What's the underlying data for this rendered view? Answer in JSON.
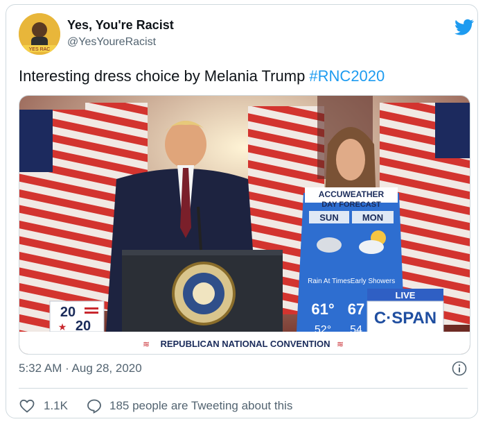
{
  "account": {
    "display_name": "Yes, You're Racist",
    "handle": "@YesYoureRacist",
    "avatar_badge_text": "YES RAC"
  },
  "tweet": {
    "text": "Interesting dress choice by Melania Trump ",
    "hashtag": "#RNC2020",
    "timestamp": "5:32 AM · Aug 28, 2020"
  },
  "media": {
    "banner": "REPUBLICAN NATIONAL CONVENTION",
    "logo_top": "20",
    "logo_bottom": "20",
    "live_label": "LIVE",
    "network": "C·SPAN",
    "forecast": {
      "brand": "ACCUWEATHER",
      "title": "DAY FORECAST",
      "day1": "SUN",
      "day2": "MON",
      "cond1": "Rain At Times",
      "cond2": "Early Showers",
      "temp1": "61°",
      "temp2": "67",
      "low1": "52°",
      "low2": "54"
    },
    "seal_text": "SEAL OF THE PRESIDENT OF THE UNITED STATES"
  },
  "actions": {
    "like_count": "1.1K",
    "reply_text": "185 people are Tweeting about this"
  },
  "colors": {
    "twitter_blue": "#1d9bf0",
    "text_primary": "#0f1419",
    "text_secondary": "#536471",
    "border": "#cfd9de",
    "cspan_blue": "#1f4ea0"
  },
  "icons": [
    "twitter-bird-icon",
    "info-icon",
    "heart-icon",
    "reply-bubble-icon"
  ]
}
